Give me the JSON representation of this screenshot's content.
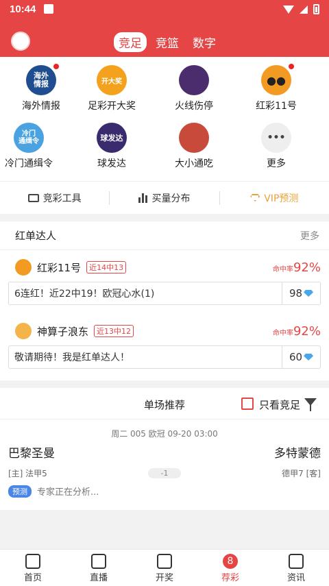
{
  "status": {
    "time": "10:44"
  },
  "header": {
    "tabs": [
      {
        "label": "竞足",
        "active": true
      },
      {
        "label": "竞篮",
        "active": false
      },
      {
        "label": "数字",
        "active": false
      }
    ]
  },
  "grid": [
    {
      "label": "海外情报",
      "icon_text": "海外\n情报",
      "badge_dot": true,
      "color": "#1f4d8f"
    },
    {
      "label": "足彩开大奖",
      "icon_text": "开大奖",
      "badge_dot": false,
      "color": "#f4a21d"
    },
    {
      "label": "火线伤停",
      "icon_text": "",
      "badge_dot": false,
      "color": "#4b2d6e"
    },
    {
      "label": "红彩11号",
      "icon_text": "",
      "badge_dot": true,
      "color": "#f39a23"
    },
    {
      "label": "冷门通缉令",
      "icon_text": "冷门\n通缉令",
      "badge_dot": false,
      "color": "#4aa3e0"
    },
    {
      "label": "球发达",
      "icon_text": "球发达",
      "badge_dot": false,
      "color": "#3a2a6e"
    },
    {
      "label": "大小通吃",
      "icon_text": "",
      "badge_dot": false,
      "color": "#c84a3a"
    },
    {
      "label": "更多",
      "icon_text": "•••",
      "badge_dot": false,
      "color": "#eeeeee"
    }
  ],
  "tools": [
    {
      "label": "竞彩工具",
      "icon": "ticket-icon"
    },
    {
      "label": "买量分布",
      "icon": "bar-chart-icon"
    },
    {
      "label": "VIP预测",
      "icon": "diamond-icon"
    }
  ],
  "red_list": {
    "title": "红单达人",
    "more": "更多",
    "experts": [
      {
        "name": "红彩11号",
        "badge": "近14中13",
        "rate_label": "命中率",
        "rate": "92%",
        "pick": "6连红！近22中19！欧冠心水(1)",
        "price": "98"
      },
      {
        "name": "神算子浪东",
        "badge": "近13中12",
        "rate_label": "命中率",
        "rate": "92%",
        "pick": "敬请期待！我是红单达人！",
        "price": "60"
      }
    ]
  },
  "recommend": {
    "title": "单场推荐",
    "only_label": "只看竞足",
    "match": {
      "meta": "周二 005 欧冠 09-20 03:00",
      "home": "巴黎圣曼",
      "away": "多特蒙德",
      "home_info": "[主] 法甲5",
      "handicap": "-1",
      "away_info": "德甲7 [客]",
      "tag": "预测",
      "status": "专家正在分析..."
    }
  },
  "bottom_nav": [
    {
      "label": "首页",
      "icon": "home-icon",
      "active": false
    },
    {
      "label": "直播",
      "icon": "play-icon",
      "active": false
    },
    {
      "label": "开奖",
      "icon": "trophy-icon",
      "active": false
    },
    {
      "label": "荐彩",
      "icon": "8",
      "active": true
    },
    {
      "label": "资讯",
      "icon": "news-icon",
      "active": false
    }
  ],
  "colors": {
    "brand": "#e64545",
    "vip": "#e8a23a",
    "tag": "#4a86e8"
  }
}
